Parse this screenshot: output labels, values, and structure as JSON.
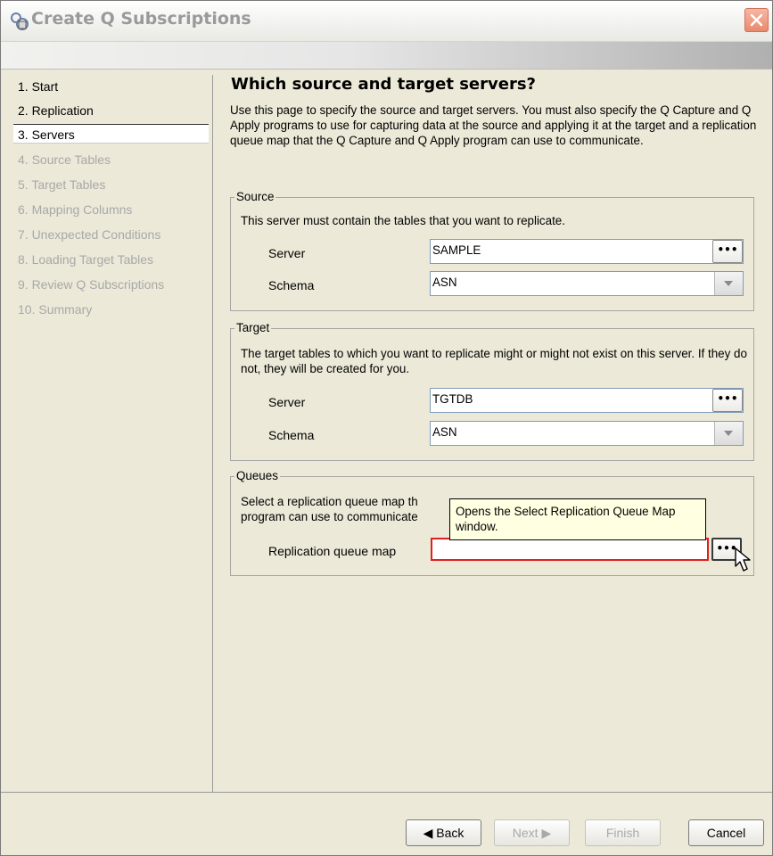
{
  "window": {
    "title": "Create Q Subscriptions",
    "close_icon": "close-icon"
  },
  "nav": {
    "items": [
      {
        "label": "1. Start",
        "state": "enabled"
      },
      {
        "label": "2. Replication",
        "state": "enabled"
      },
      {
        "label": "3. Servers",
        "state": "selected"
      },
      {
        "label": "4. Source Tables",
        "state": "disabled"
      },
      {
        "label": "5. Target Tables",
        "state": "disabled"
      },
      {
        "label": "6. Mapping Columns",
        "state": "disabled"
      },
      {
        "label": "7. Unexpected Conditions",
        "state": "disabled"
      },
      {
        "label": "8. Loading Target Tables",
        "state": "disabled"
      },
      {
        "label": "9. Review Q Subscriptions",
        "state": "disabled"
      },
      {
        "label": "10. Summary",
        "state": "disabled"
      }
    ]
  },
  "page": {
    "title": "Which source and target servers?",
    "description": "Use this page to specify the source and target servers. You must also specify the Q Capture and Q Apply programs to use for capturing data at the source and applying it at the target and a replication queue map that the Q Capture and Q Apply program can use to communicate."
  },
  "source": {
    "legend": "Source",
    "description": "This server must contain the tables that you want to replicate.",
    "server_label": "Server",
    "server_value": "SAMPLE",
    "schema_label": "Schema",
    "schema_value": "ASN"
  },
  "target": {
    "legend": "Target",
    "description": "The target tables to which you want to replicate might or might not exist on this server. If they do not, they will be created for you.",
    "server_label": "Server",
    "server_value": "TGTDB",
    "schema_label": "Schema",
    "schema_value": "ASN"
  },
  "queues": {
    "legend": "Queues",
    "description_line1": "Select a replication queue map th",
    "description_line2": "program can use to communicate",
    "map_label": "Replication queue map",
    "map_value": ""
  },
  "browse_label": "•••",
  "tooltip": "Opens the Select Replication Queue Map window.",
  "buttons": {
    "back": "◀ Back",
    "next": "Next ▶",
    "finish": "Finish",
    "cancel": "Cancel"
  },
  "colors": {
    "required_field_border": "#e02020",
    "tooltip_bg": "#ffffe1",
    "disabled_text": "#a8a8a8"
  }
}
